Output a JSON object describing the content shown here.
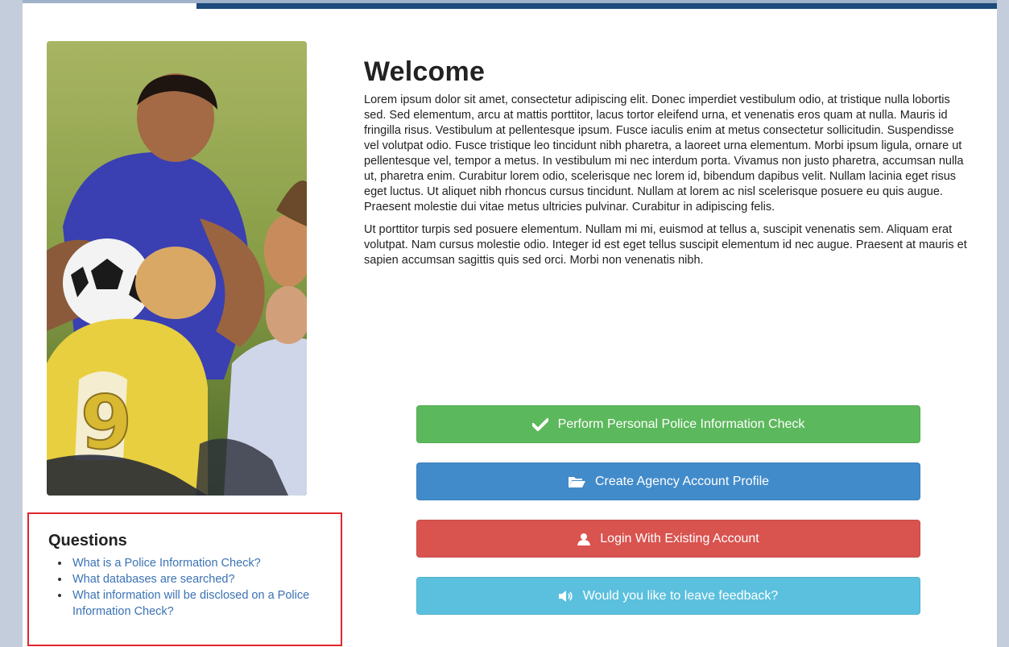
{
  "welcome": {
    "title": "Welcome",
    "paragraphs": [
      "Lorem ipsum dolor sit amet, consectetur adipiscing elit. Donec imperdiet vestibulum odio, at tristique nulla lobortis sed. Sed elementum, arcu at mattis porttitor, lacus tortor eleifend urna, et venenatis eros quam at nulla. Mauris id fringilla risus. Vestibulum at pellentesque ipsum. Fusce iaculis enim at metus consectetur sollicitudin. Suspendisse vel volutpat odio. Fusce tristique leo tincidunt nibh pharetra, a laoreet urna elementum. Morbi ipsum ligula, ornare ut pellentesque vel, tempor a metus. In vestibulum mi nec interdum porta. Vivamus non justo pharetra, accumsan nulla ut, pharetra enim. Curabitur lorem odio, scelerisque nec lorem id, bibendum dapibus velit. Nullam lacinia eget risus eget luctus. Ut aliquet nibh rhoncus cursus tincidunt. Nullam at lorem ac nisl scelerisque posuere eu quis augue. Praesent molestie dui vitae metus ultricies pulvinar. Curabitur in adipiscing felis.",
      "Ut porttitor turpis sed posuere elementum. Nullam mi mi, euismod at tellus a, suscipit venenatis sem. Aliquam erat volutpat. Nam cursus molestie odio. Integer id est eget tellus suscipit elementum id nec augue. Praesent at mauris et sapien accumsan sagittis quis sed orci. Morbi non venenatis nibh."
    ]
  },
  "actions": {
    "perform_check": {
      "label": "Perform Personal Police Information Check",
      "icon": "checkmark-icon",
      "color": "#5cb85c"
    },
    "create_account": {
      "label": "Create Agency Account Profile",
      "icon": "folder-open-icon",
      "color": "#428bca"
    },
    "login": {
      "label": "Login With Existing Account",
      "icon": "user-icon",
      "color": "#d9534f"
    },
    "feedback": {
      "label": "Would you like to leave feedback?",
      "icon": "volume-icon",
      "color": "#5bc0de"
    }
  },
  "carousel": {
    "prev": "‹",
    "pause": "II",
    "next": "›"
  },
  "questions": {
    "title": "Questions",
    "items": [
      "What is a Police Information Check?",
      "What databases are searched?",
      "What information will be disclosed on a Police Information Check?"
    ]
  },
  "colors": {
    "header_accent": "#1e4a7c",
    "link": "#3a72b4",
    "highlight_border": "#e0262b"
  }
}
